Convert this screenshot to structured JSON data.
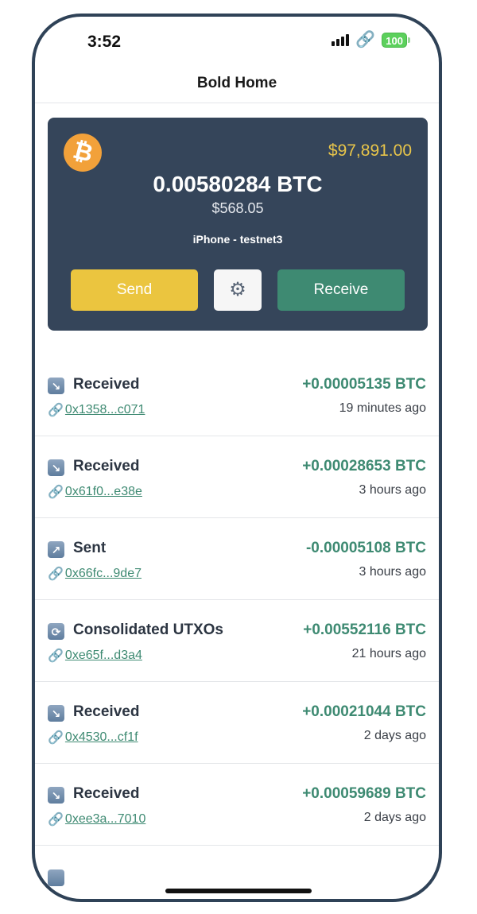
{
  "status_bar": {
    "time": "3:52",
    "battery": "100",
    "link_glyph": "🔗"
  },
  "nav": {
    "title": "Bold Home"
  },
  "wallet": {
    "price": "$97,891.00",
    "balance": "0.00580284 BTC",
    "fiat": "$568.05",
    "name": "iPhone - testnet3",
    "logo_glyph": "₿",
    "send_label": "Send",
    "receive_label": "Receive",
    "settings_glyph": "⚙"
  },
  "transactions": [
    {
      "type": "Received",
      "icon": "↘",
      "hash": "0x1358...c071",
      "amount": "+0.00005135 BTC",
      "time": "19 minutes ago"
    },
    {
      "type": "Received",
      "icon": "↘",
      "hash": "0x61f0...e38e",
      "amount": "+0.00028653 BTC",
      "time": "3 hours ago"
    },
    {
      "type": "Sent",
      "icon": "↗",
      "hash": "0x66fc...9de7",
      "amount": "-0.00005108 BTC",
      "time": "3 hours ago"
    },
    {
      "type": "Consolidated UTXOs",
      "icon": "⟳",
      "hash": "0xe65f...d3a4",
      "amount": "+0.00552116 BTC",
      "time": "21 hours ago"
    },
    {
      "type": "Received",
      "icon": "↘",
      "hash": "0x4530...cf1f",
      "amount": "+0.00021044 BTC",
      "time": "2 days ago"
    },
    {
      "type": "Received",
      "icon": "↘",
      "hash": "0xee3a...7010",
      "amount": "+0.00059689 BTC",
      "time": "2 days ago"
    }
  ],
  "chain_glyph": "🔗",
  "colors": {
    "card": "#35455a",
    "send": "#ebc53f",
    "receive": "#3e8a72",
    "price": "#e8c54a",
    "border": "#2f4257"
  }
}
